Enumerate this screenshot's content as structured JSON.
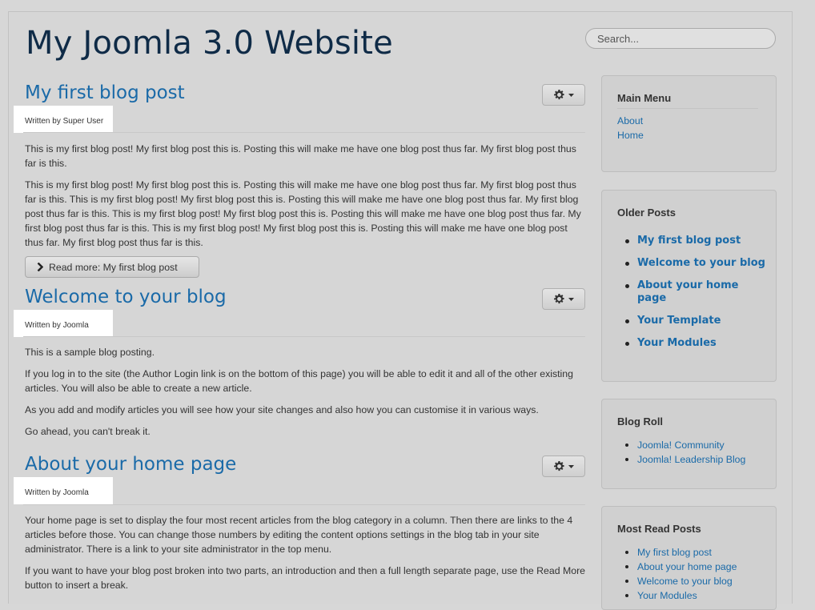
{
  "site": {
    "title": "My Joomla 3.0 Website",
    "search_placeholder": "Search..."
  },
  "articles": [
    {
      "title": "My first blog post",
      "byline": "Written by Super User",
      "paragraphs": [
        "This is my first blog post! My first blog post this is. Posting this will make me have one blog post thus far. My first blog post thus far is this.",
        "This is my first blog post! My first blog post this is. Posting this will make me have one blog post thus far. My first blog post thus far is this. This is my first blog post! My first blog post this is. Posting this will make me have one blog post thus far. My first blog post thus far is this. This is my first blog post! My first blog post this is. Posting this will make me have one blog post thus far. My first blog post thus far is this. This is my first blog post! My first blog post this is. Posting this will make me have one blog post thus far. My first blog post thus far is this."
      ],
      "read_more": "Read more: My first blog post"
    },
    {
      "title": "Welcome to your blog",
      "byline": "Written by Joomla",
      "paragraphs": [
        "This is a sample blog posting.",
        "If you log in to the site (the Author Login link is on the bottom of this page) you will be able to edit it and all of the other existing articles. You will also be able to create a new article.",
        "As you add and modify articles you will see how your site changes and also how you can customise it in various ways.",
        "Go ahead, you can't break it."
      ]
    },
    {
      "title": "About your home page",
      "byline": "Written by Joomla",
      "paragraphs": [
        "Your home page is set to display the four most recent articles from the blog category in a column. Then there are links to the 4 articles before those. You can change those numbers by editing the content options settings in the blog tab in your site administrator. There is a link to your site administrator in the top menu.",
        "If you want to have your blog post broken into two parts, an introduction and then a full length separate page, use the Read More button to insert a break."
      ]
    }
  ],
  "sidebar": {
    "main_menu": {
      "title": "Main Menu",
      "items": [
        "About",
        "Home"
      ]
    },
    "older_posts": {
      "title": "Older Posts",
      "items": [
        "My first blog post",
        "Welcome to your blog",
        "About your home page",
        "Your Template",
        "Your Modules"
      ]
    },
    "blog_roll": {
      "title": "Blog Roll",
      "items": [
        "Joomla! Community",
        "Joomla! Leadership Blog"
      ]
    },
    "most_read": {
      "title": "Most Read Posts",
      "items": [
        "My first blog post",
        "About your home page",
        "Welcome to your blog",
        "Your Modules"
      ]
    }
  },
  "icons": {
    "gear": "gear-icon",
    "caret": "caret-down-icon",
    "chevron": "chevron-right-icon"
  }
}
